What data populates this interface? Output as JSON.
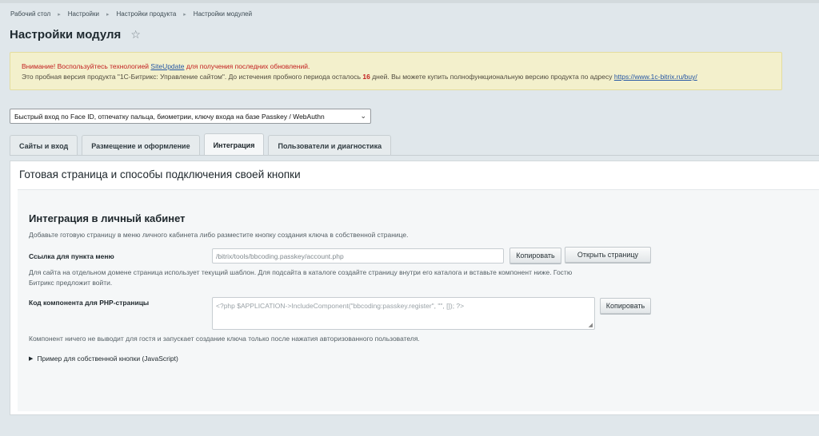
{
  "breadcrumb": [
    "Рабочий стол",
    "Настройки",
    "Настройки продукта",
    "Настройки модулей"
  ],
  "page_title": "Настройки модуля",
  "alert": {
    "line1_pre": "Внимание! Воспользуйтесь технологией ",
    "line1_link": "SiteUpdate",
    "line1_post": " для получения последних обновлений.",
    "line2_pre": "Это пробная версия продукта \"1С-Битрикс: Управление сайтом\". До истечения пробного периода осталось ",
    "line2_days": "16",
    "line2_mid": " дней. Вы можете купить полнофункциональную версию продукта по адресу ",
    "line2_link": "https://www.1c-bitrix.ru/buy/"
  },
  "module_select": {
    "selected": "Быстрый вход по Face ID, отпечатку пальца, биометрии, ключу входа на базе Passkey / WebAuthn"
  },
  "tabs": [
    {
      "label": "Сайты и вход",
      "active": false
    },
    {
      "label": "Размещение и оформление",
      "active": false
    },
    {
      "label": "Интеграция",
      "active": true
    },
    {
      "label": "Пользователи и диагностика",
      "active": false
    }
  ],
  "panel_title": "Готовая страница и способы подключения своей кнопки",
  "section": {
    "title": "Интеграция в личный кабинет",
    "description": "Добавьте готовую страницу в меню личного кабинета либо разместите кнопку создания ключа в собственной странице.",
    "menu_link": {
      "label": "Ссылка для пункта меню",
      "value": "/bitrix/tools/bbcoding.passkey/account.php",
      "copy_label": "Копировать",
      "open_label": "Открыть страницу"
    },
    "menu_hint_line1": "Для сайта на отдельном домене страница использует текущий шаблон. Для подсайта в каталоге создайте страницу внутри его каталога и вставьте компонент ниже. Гостю",
    "menu_hint_line2": "Битрикс предложит войти.",
    "component_code": {
      "label": "Код компонента для PHP-страницы",
      "value": "<?php $APPLICATION->IncludeComponent(\"bbcoding:passkey.register\", \"\", []); ?>",
      "copy_label": "Копировать"
    },
    "component_hint": "Компонент ничего не выводит для гостя и запускает создание ключа только после нажатия авторизованного пользователя.",
    "js_example_label": "Пример для собственной кнопки (JavaScript)"
  }
}
